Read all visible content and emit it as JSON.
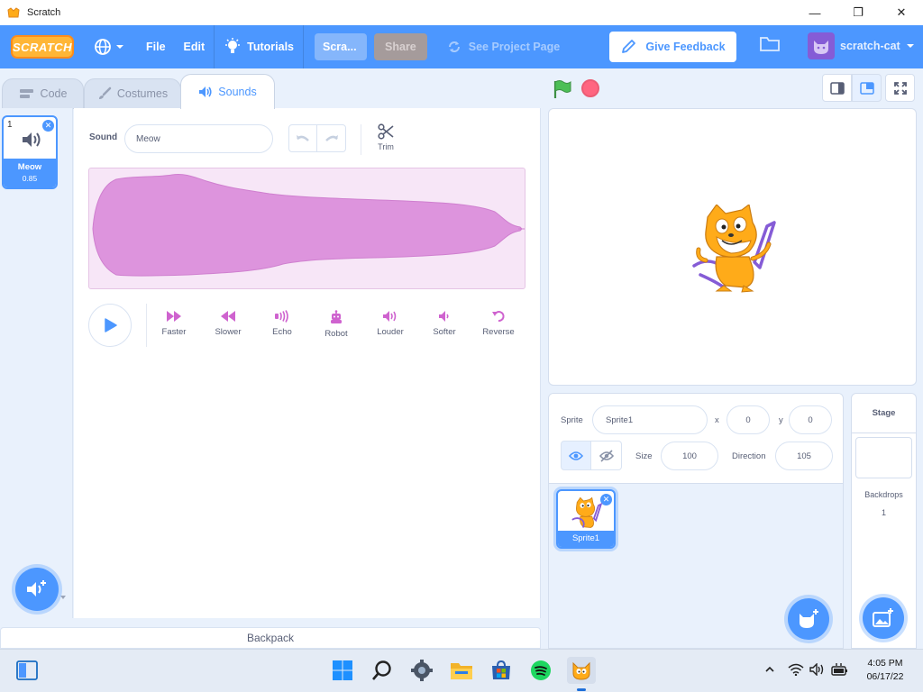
{
  "window": {
    "title": "Scratch",
    "minimize": "—",
    "maximize": "❐",
    "close": "✕"
  },
  "menubar": {
    "logo": "SCRATCH",
    "file": "File",
    "edit": "Edit",
    "tutorials": "Tutorials",
    "project_title": "Scra...",
    "share": "Share",
    "see_project_page": "See Project Page",
    "give_feedback": "Give Feedback",
    "username": "scratch-cat"
  },
  "tabs": {
    "code": "Code",
    "costumes": "Costumes",
    "sounds": "Sounds",
    "active": "sounds"
  },
  "sound_list": [
    {
      "index": "1",
      "name": "Meow",
      "duration": "0.85"
    }
  ],
  "editor": {
    "sound_label": "Sound",
    "sound_name": "Meow",
    "trim": "Trim",
    "effects": [
      "Faster",
      "Slower",
      "Echo",
      "Robot",
      "Louder",
      "Softer",
      "Reverse"
    ]
  },
  "backpack": "Backpack",
  "sprite_info": {
    "sprite_label": "Sprite",
    "sprite_name": "Sprite1",
    "x_label": "x",
    "x": "0",
    "y_label": "y",
    "y": "0",
    "size_label": "Size",
    "size": "100",
    "direction_label": "Direction",
    "direction": "105"
  },
  "sprites": [
    {
      "name": "Sprite1"
    }
  ],
  "stage_pane": {
    "title": "Stage",
    "backdrops_label": "Backdrops",
    "backdrops_count": "1"
  },
  "taskbar": {
    "time": "4:05 PM",
    "date": "06/17/22"
  },
  "colors": {
    "scratch_blue": "#4c97ff",
    "sound_wave": "#dd94dd",
    "sound_effect": "#cf63cf",
    "stop": "#ff6680",
    "flag": "#4cbf56"
  }
}
